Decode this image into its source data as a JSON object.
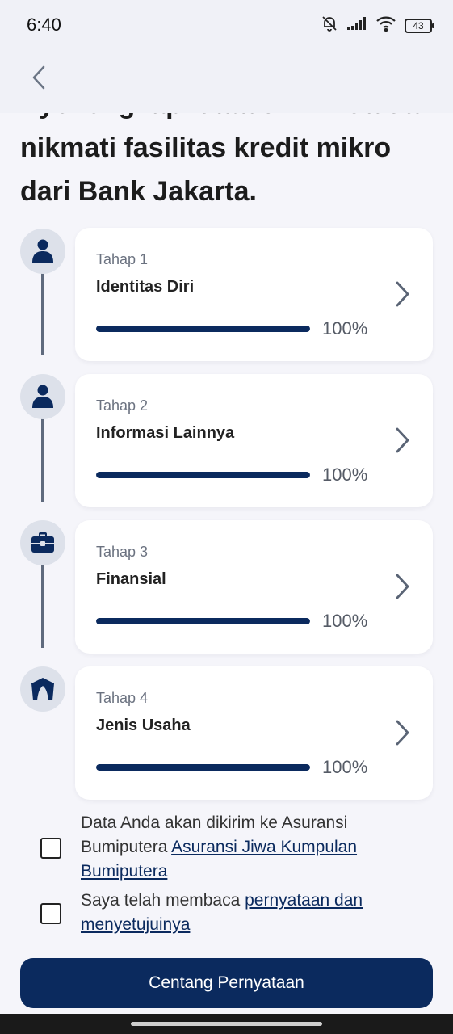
{
  "status_bar": {
    "time": "6:40",
    "battery": "43",
    "icons": [
      "bell-off-icon",
      "signal-icon",
      "wifi-icon",
      "battery-icon"
    ]
  },
  "header": {
    "back_icon": "chevron-left-icon"
  },
  "intro": {
    "text": "Ayo lengkapi data diri Anda dan nikmati fasilitas kredit mikro dari Bank Jakarta."
  },
  "steps": [
    {
      "tag": "Tahap 1",
      "title": "Identitas Diri",
      "progress_pct": 100,
      "progress_label": "100%",
      "icon": "person-icon"
    },
    {
      "tag": "Tahap 2",
      "title": "Informasi Lainnya",
      "progress_pct": 100,
      "progress_label": "100%",
      "icon": "person-icon"
    },
    {
      "tag": "Tahap 3",
      "title": "Finansial",
      "progress_pct": 100,
      "progress_label": "100%",
      "icon": "briefcase-icon"
    },
    {
      "tag": "Tahap 4",
      "title": "Jenis Usaha",
      "progress_pct": 100,
      "progress_label": "100%",
      "icon": "tent-icon"
    }
  ],
  "consent": {
    "items": [
      {
        "text": "Data Anda akan dikirim ke Asuransi Bumiputera ",
        "link": "Asuransi Jiwa Kumpulan Bumiputera",
        "checked": false
      },
      {
        "text": "Saya telah membaca ",
        "link": "pernyataan dan menyetujuinya",
        "checked": false
      }
    ]
  },
  "button": {
    "label": "Centang Pernyataan"
  },
  "colors": {
    "primary": "#0b2a5e",
    "background": "#f5f5fa",
    "card": "#ffffff",
    "icon_bg": "#dde1ea"
  }
}
